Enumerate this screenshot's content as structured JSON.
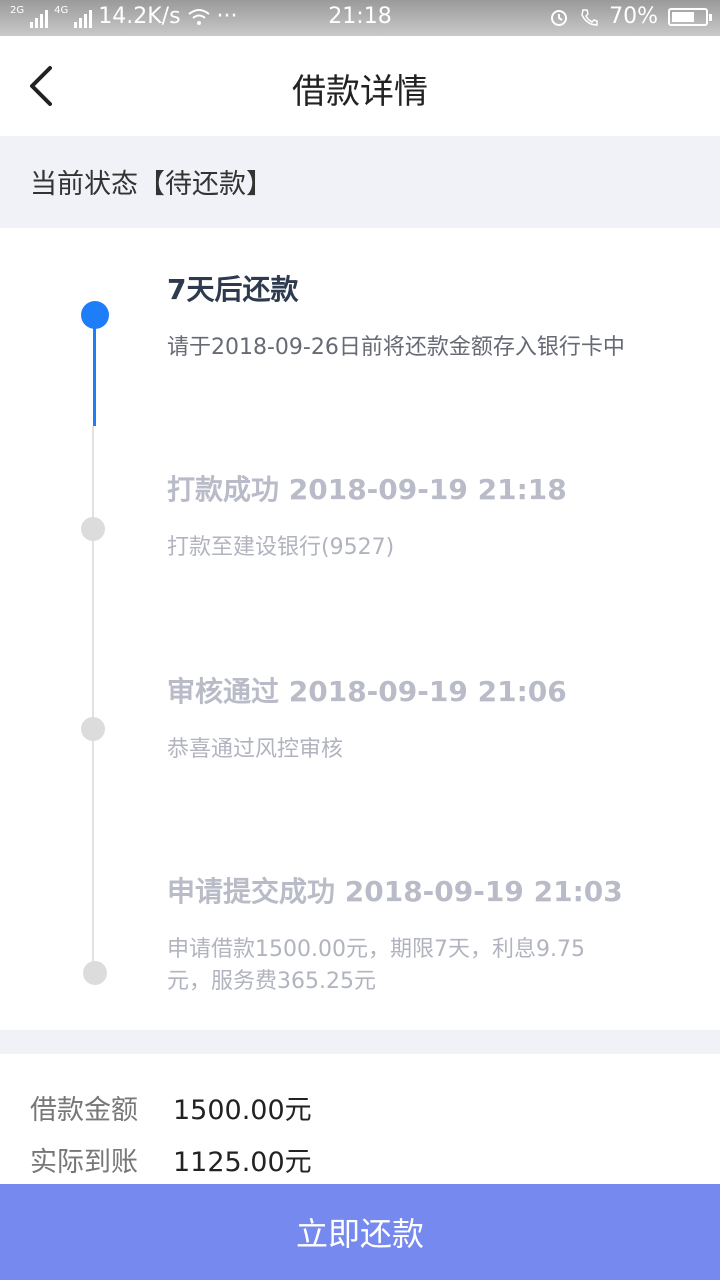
{
  "status_bar": {
    "network_2g": "2G",
    "network_4g": "4G",
    "speed": "14.2K/s",
    "more": "···",
    "time": "21:18",
    "battery": "70%",
    "battery_level": 0.7
  },
  "header": {
    "title": "借款详情",
    "back_icon": "chevron-left-icon"
  },
  "status": {
    "text": "当前状态【待还款】"
  },
  "timeline": [
    {
      "title": "7天后还款",
      "desc": "请于2018-09-26日前将还款金额存入银行卡中",
      "state": "active"
    },
    {
      "title": "打款成功 2018-09-19 21:18",
      "desc": "打款至建设银行(9527)",
      "state": "done"
    },
    {
      "title": "审核通过 2018-09-19 21:06",
      "desc": "恭喜通过风控审核",
      "state": "done"
    },
    {
      "title": "申请提交成功 2018-09-19 21:03",
      "desc": "申请借款1500.00元，期限7天，利息9.75元，服务费365.25元",
      "state": "done"
    }
  ],
  "summary": {
    "amount_label": "借款金额",
    "amount_value": "1500.00元",
    "received_label": "实际到账",
    "received_value": "1125.00元"
  },
  "action": {
    "repay_label": "立即还款"
  },
  "colors": {
    "accent": "#1e7ef7",
    "button": "#7689ef",
    "strip": "#f0f2f7"
  }
}
